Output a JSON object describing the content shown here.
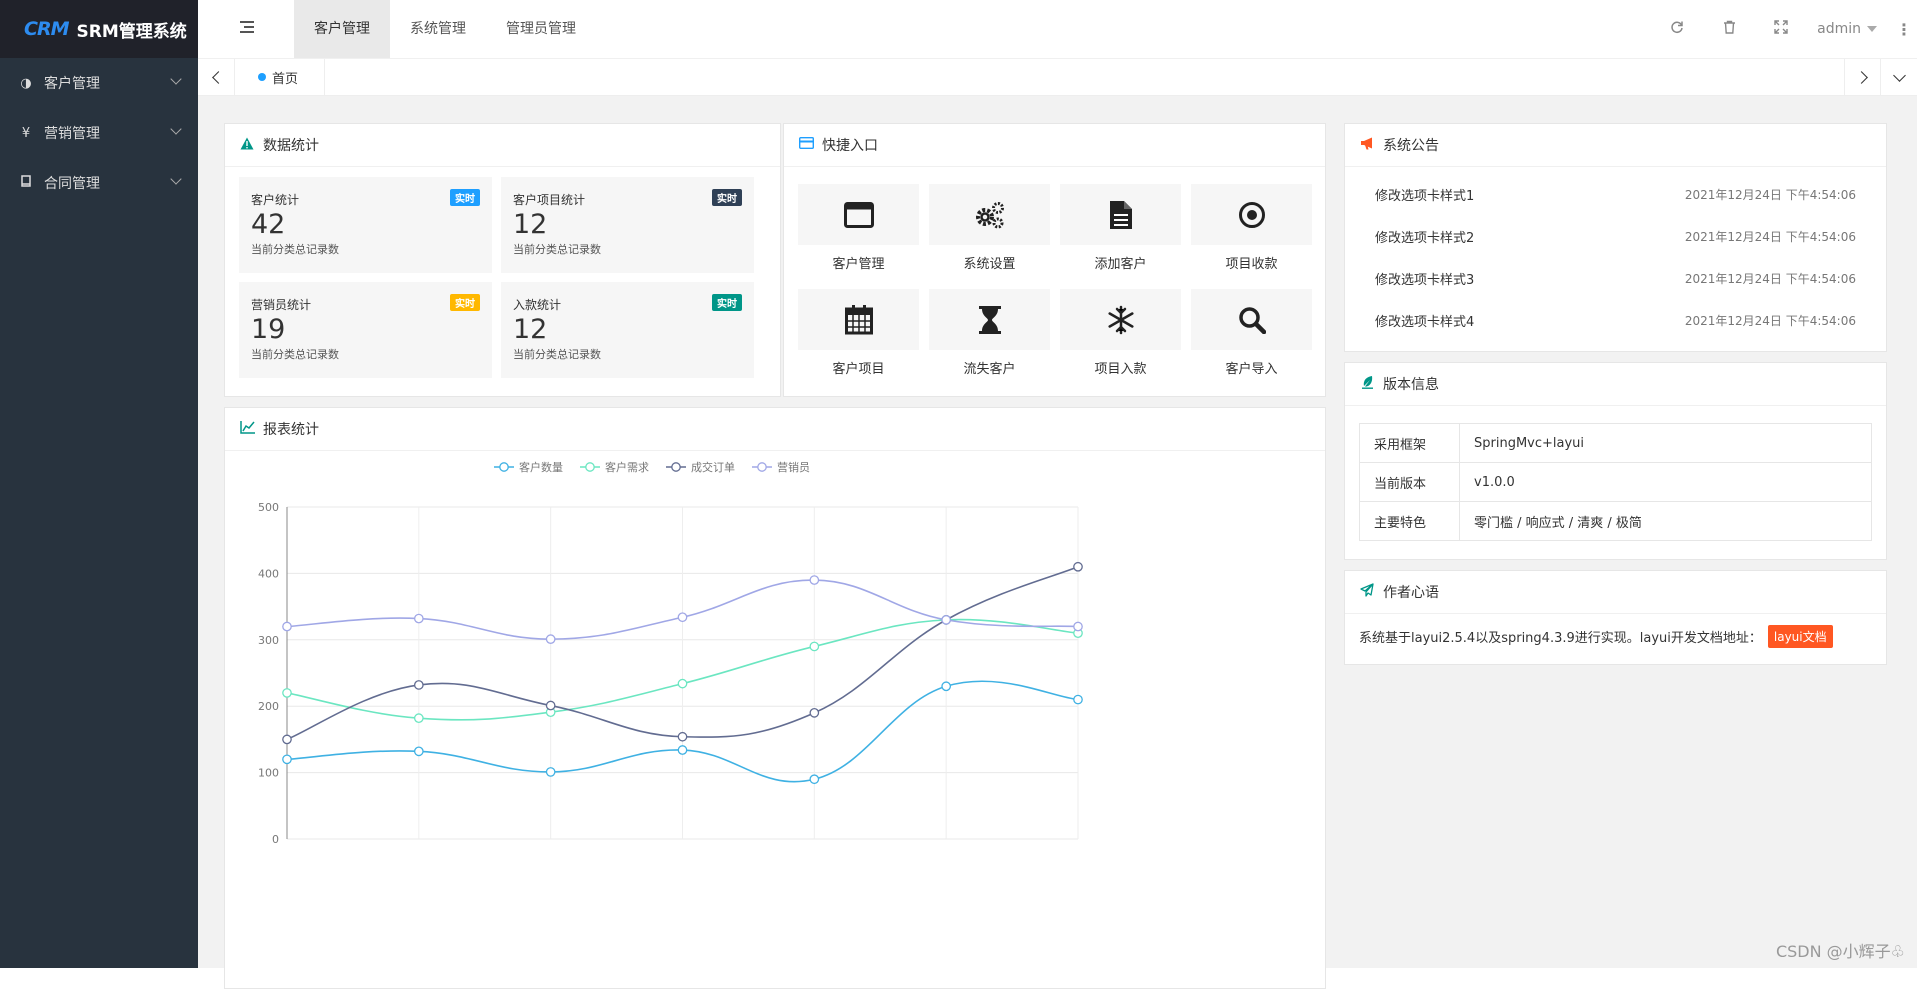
{
  "app": {
    "logo_mark": "CRM",
    "title": "SRM管理系统"
  },
  "sidebar": {
    "items": [
      {
        "label": "客户管理",
        "icon": "half-circle-icon"
      },
      {
        "label": "营销管理",
        "icon": "yen-icon"
      },
      {
        "label": "合同管理",
        "icon": "book-icon"
      }
    ]
  },
  "topnav": {
    "items": [
      "客户管理",
      "系统管理",
      "管理员管理"
    ],
    "active": 0
  },
  "header_right": {
    "user": "admin"
  },
  "tabs": {
    "home": "首页"
  },
  "stats": {
    "title": "数据统计",
    "items": [
      {
        "label": "客户统计",
        "value": "42",
        "desc": "当前分类总记录数",
        "badge": "实时",
        "badge_color": "#1e9fff"
      },
      {
        "label": "客户项目统计",
        "value": "12",
        "desc": "当前分类总记录数",
        "badge": "实时",
        "badge_color": "#2f4056"
      },
      {
        "label": "营销员统计",
        "value": "19",
        "desc": "当前分类总记录数",
        "badge": "实时",
        "badge_color": "#ffb800"
      },
      {
        "label": "入款统计",
        "value": "12",
        "desc": "当前分类总记录数",
        "badge": "实时",
        "badge_color": "#009688"
      }
    ]
  },
  "shortcuts": {
    "title": "快捷入口",
    "items": [
      {
        "label": "客户管理",
        "icon": "window-icon"
      },
      {
        "label": "系统设置",
        "icon": "gears-icon"
      },
      {
        "label": "添加客户",
        "icon": "file-icon"
      },
      {
        "label": "项目收款",
        "icon": "target-icon"
      },
      {
        "label": "客户项目",
        "icon": "calendar-icon"
      },
      {
        "label": "流失客户",
        "icon": "hourglass-icon"
      },
      {
        "label": "项目入款",
        "icon": "snowflake-icon"
      },
      {
        "label": "客户导入",
        "icon": "search-icon"
      }
    ]
  },
  "report": {
    "title": "报表统计"
  },
  "notices": {
    "title": "系统公告",
    "items": [
      {
        "title": "修改选项卡样式1",
        "date": "2021年12月24日 下午4:54:06"
      },
      {
        "title": "修改选项卡样式2",
        "date": "2021年12月24日 下午4:54:06"
      },
      {
        "title": "修改选项卡样式3",
        "date": "2021年12月24日 下午4:54:06"
      },
      {
        "title": "修改选项卡样式4",
        "date": "2021年12月24日 下午4:54:06"
      }
    ]
  },
  "version": {
    "title": "版本信息",
    "rows": [
      {
        "k": "采用框架",
        "v": "SpringMvc+layui"
      },
      {
        "k": "当前版本",
        "v": "v1.0.0"
      },
      {
        "k": "主要特色",
        "v": "零门槛 / 响应式 / 清爽 / 极简"
      }
    ]
  },
  "author": {
    "title": "作者心语",
    "text": "系统基于layui2.5.4以及spring4.3.9进行实现。layui开发文档地址：",
    "button": "layui文档"
  },
  "watermark": "CSDN @小辉子♧",
  "chart_data": {
    "type": "line",
    "x": [
      0,
      1,
      2,
      3,
      4,
      5,
      6
    ],
    "ylim": [
      0,
      500
    ],
    "yticks": [
      "0",
      "100",
      "200",
      "300",
      "400",
      "500"
    ],
    "legend_position": "top",
    "smooth": true,
    "series": [
      {
        "name": "客户数量",
        "color": "#3fb1e3",
        "values": [
          120,
          132,
          101,
          134,
          90,
          230,
          210
        ]
      },
      {
        "name": "客户需求",
        "color": "#6be6c1",
        "values": [
          220,
          182,
          191,
          234,
          290,
          330,
          310
        ]
      },
      {
        "name": "成交订单",
        "color": "#626c91",
        "values": [
          150,
          232,
          201,
          154,
          190,
          330,
          410
        ]
      },
      {
        "name": "营销员",
        "color": "#a0a7e6",
        "values": [
          320,
          332,
          301,
          334,
          390,
          330,
          320
        ]
      }
    ]
  }
}
